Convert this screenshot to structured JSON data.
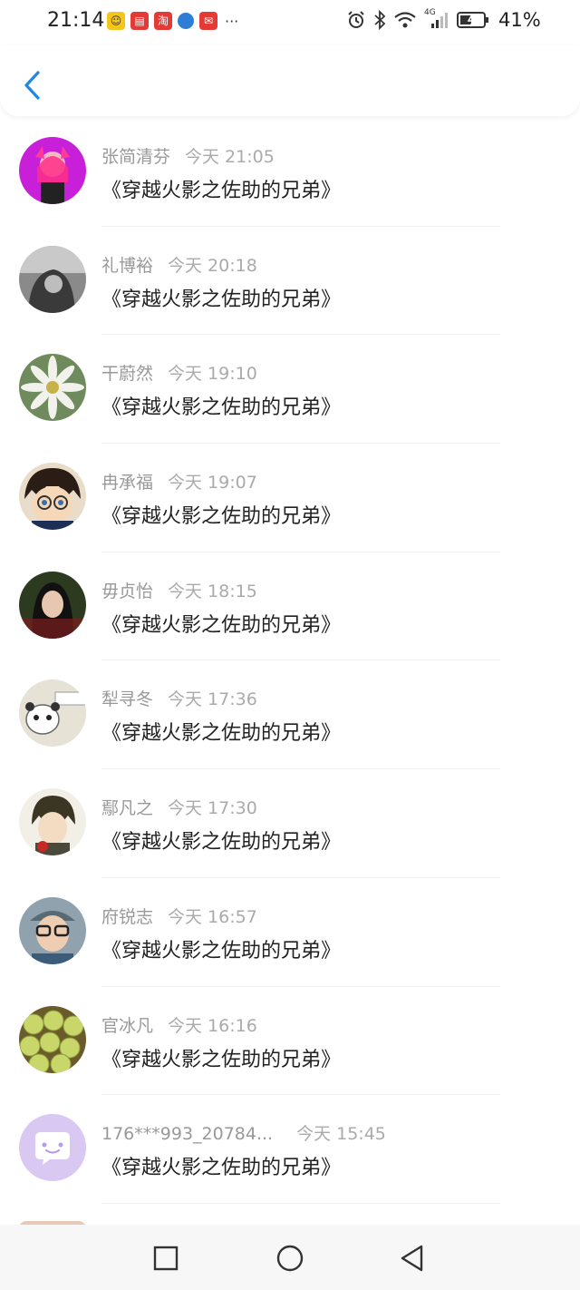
{
  "status_bar": {
    "time": "21:14",
    "battery_text": "41%",
    "network": "4G"
  },
  "header": {
    "back_icon": "chevron-left-icon"
  },
  "messages": [
    {
      "name": "张简清芬",
      "time": "今天 21:05",
      "text": "《穿越火影之佐助的兄弟》"
    },
    {
      "name": "礼博裕",
      "time": "今天 20:18",
      "text": "《穿越火影之佐助的兄弟》"
    },
    {
      "name": "干蔚然",
      "time": "今天 19:10",
      "text": "《穿越火影之佐助的兄弟》"
    },
    {
      "name": "冉承福",
      "time": "今天 19:07",
      "text": "《穿越火影之佐助的兄弟》"
    },
    {
      "name": "毋贞怡",
      "time": "今天 18:15",
      "text": "《穿越火影之佐助的兄弟》"
    },
    {
      "name": "犁寻冬",
      "time": "今天 17:36",
      "text": "《穿越火影之佐助的兄弟》"
    },
    {
      "name": "鄢凡之",
      "time": "今天 17:30",
      "text": "《穿越火影之佐助的兄弟》"
    },
    {
      "name": "府锐志",
      "time": "今天 16:57",
      "text": "《穿越火影之佐助的兄弟》"
    },
    {
      "name": "官冰凡",
      "time": "今天 16:16",
      "text": "《穿越火影之佐助的兄弟》"
    },
    {
      "name": "176***993_20784...",
      "time": "今天 15:45",
      "text": "《穿越火影之佐助的兄弟》"
    }
  ],
  "colors": {
    "accent": "#1e88e5",
    "name_gray": "#999999",
    "text_dark": "#222222",
    "default_avatar_bg": "#d9c8f2"
  }
}
